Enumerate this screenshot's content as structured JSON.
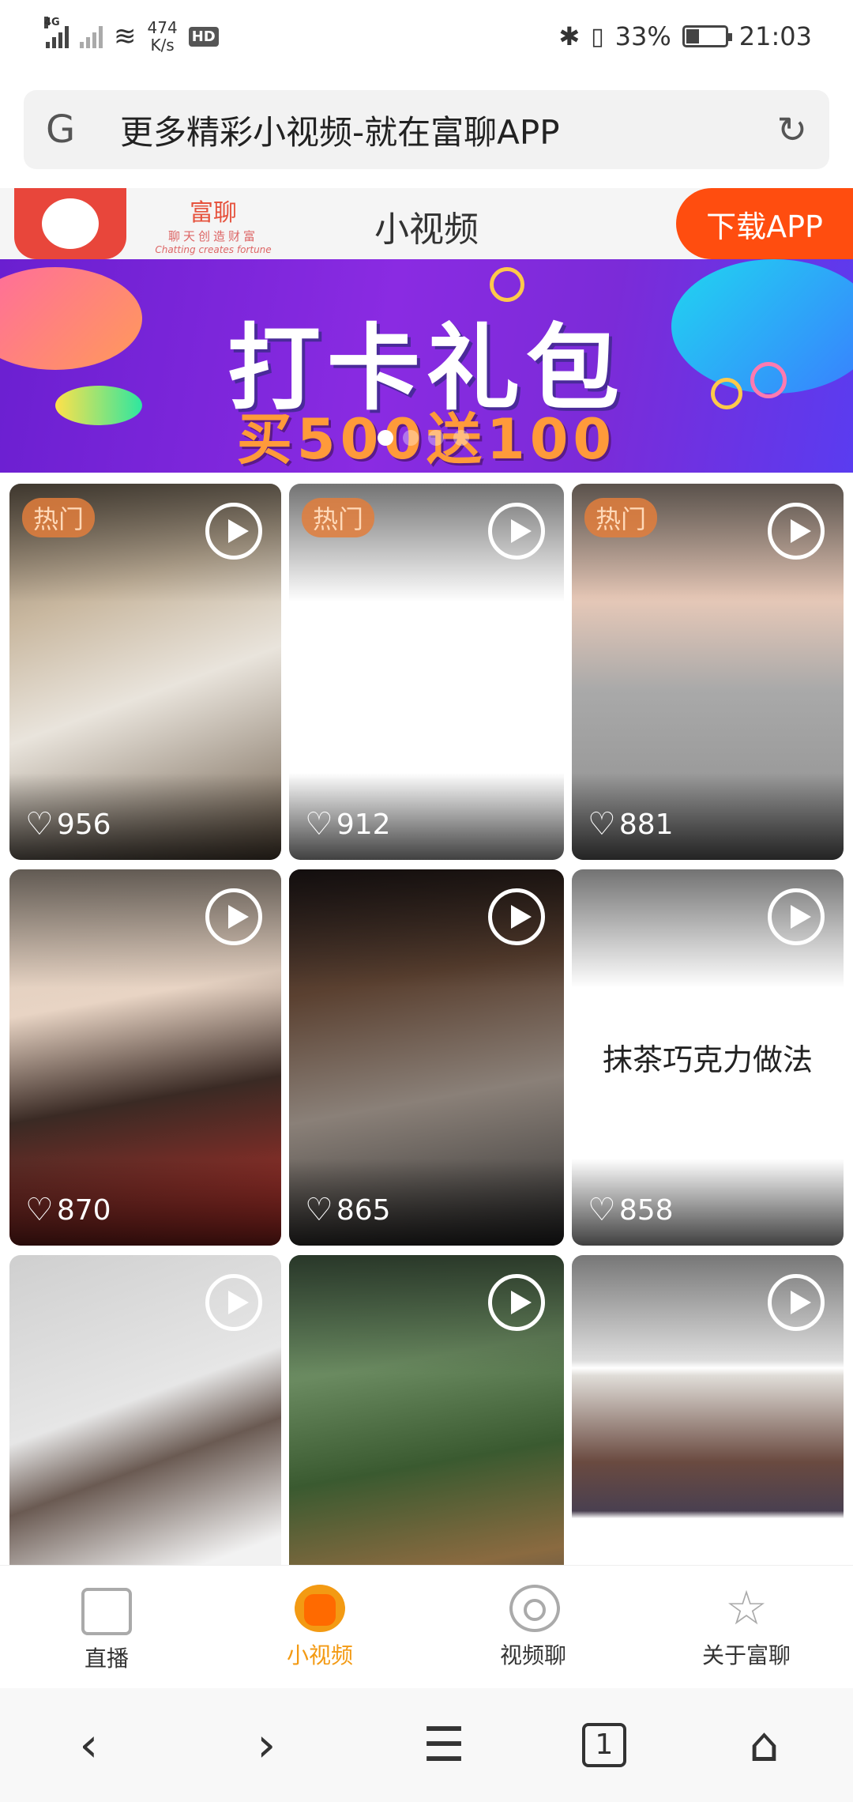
{
  "status_bar": {
    "network_tag": "4G",
    "speed_value": "474",
    "speed_unit": "K/s",
    "hd_badge": "HD",
    "battery_percent": "33%",
    "battery_level": 0.33,
    "time": "21:03"
  },
  "url_bar": {
    "text": "更多精彩小视频-就在富聊APP"
  },
  "app_header": {
    "brand_name": "富聊",
    "brand_slogan": "聊天创造财富",
    "brand_slogan_en": "Chatting creates fortune",
    "title": "小视频",
    "download_label": "下载APP"
  },
  "banner": {
    "title": "打卡礼包",
    "subtitle": "买500送100",
    "page_count": 4,
    "active_page": 1
  },
  "videos": [
    {
      "hot_label": "热门",
      "likes": "956",
      "caption": ""
    },
    {
      "hot_label": "热门",
      "likes": "912",
      "caption": ""
    },
    {
      "hot_label": "热门",
      "likes": "881",
      "caption": ""
    },
    {
      "hot_label": "",
      "likes": "870",
      "caption": ""
    },
    {
      "hot_label": "",
      "likes": "865",
      "caption": ""
    },
    {
      "hot_label": "",
      "likes": "858",
      "caption": "抹茶巧克力做法"
    },
    {
      "hot_label": "",
      "likes": "",
      "caption": ""
    },
    {
      "hot_label": "",
      "likes": "",
      "caption": ""
    },
    {
      "hot_label": "",
      "likes": "",
      "caption": ""
    }
  ],
  "tab_bar": {
    "items": [
      {
        "label": "直播",
        "icon": "tv-icon"
      },
      {
        "label": "小视频",
        "icon": "short-video-icon",
        "active": true
      },
      {
        "label": "视频聊",
        "icon": "video-chat-icon"
      },
      {
        "label": "关于富聊",
        "icon": "star-icon"
      }
    ]
  },
  "system_nav": {
    "tab_count": "1"
  },
  "colors": {
    "accent": "#f39a13",
    "download_button": "#ff4d0f",
    "banner_purple": "#8a2be2"
  }
}
